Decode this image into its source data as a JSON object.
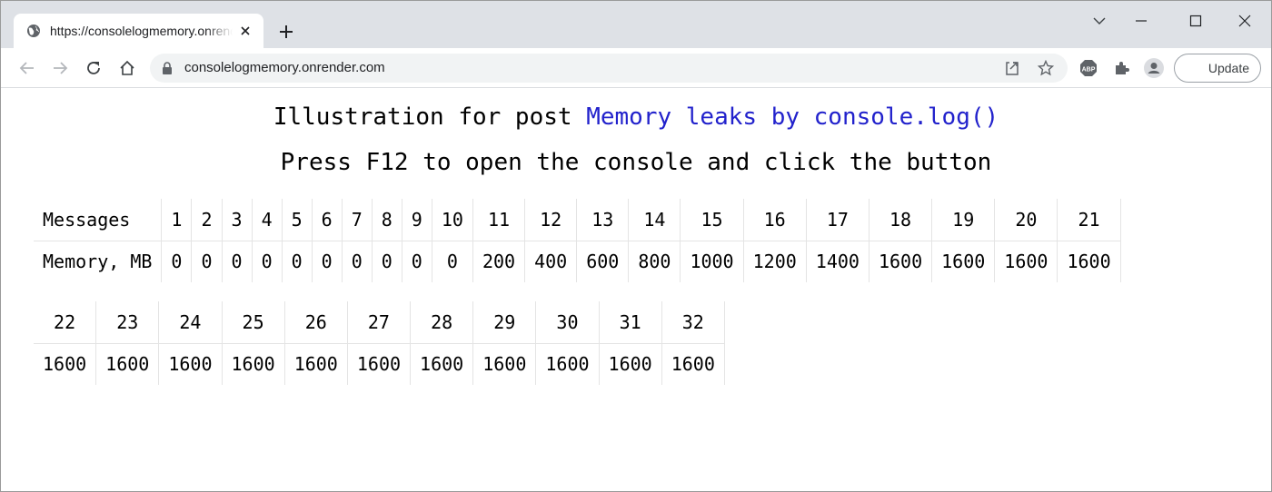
{
  "browser": {
    "tab_title": "https://consolelogmemory.onrender.com",
    "url": "consolelogmemory.onrender.com",
    "update_label": "Update",
    "extension_label": "ABP"
  },
  "page": {
    "heading_prefix": "Illustration for post ",
    "heading_link": "Memory leaks by console.log()",
    "instruction": "Press F12 to open the console and click the button",
    "row_label_messages": "Messages",
    "row_label_memory": "Memory, MB",
    "table1": {
      "messages": [
        "1",
        "2",
        "3",
        "4",
        "5",
        "6",
        "7",
        "8",
        "9",
        "10",
        "11",
        "12",
        "13",
        "14",
        "15",
        "16",
        "17",
        "18",
        "19",
        "20",
        "21"
      ],
      "memory": [
        "0",
        "0",
        "0",
        "0",
        "0",
        "0",
        "0",
        "0",
        "0",
        "0",
        "200",
        "400",
        "600",
        "800",
        "1000",
        "1200",
        "1400",
        "1600",
        "1600",
        "1600",
        "1600"
      ]
    },
    "table2": {
      "messages": [
        "22",
        "23",
        "24",
        "25",
        "26",
        "27",
        "28",
        "29",
        "30",
        "31",
        "32"
      ],
      "memory": [
        "1600",
        "1600",
        "1600",
        "1600",
        "1600",
        "1600",
        "1600",
        "1600",
        "1600",
        "1600",
        "1600"
      ]
    }
  },
  "colors": {
    "link": "#2222cc",
    "tabstrip": "#dee1e6",
    "omnibox": "#f1f3f4"
  }
}
